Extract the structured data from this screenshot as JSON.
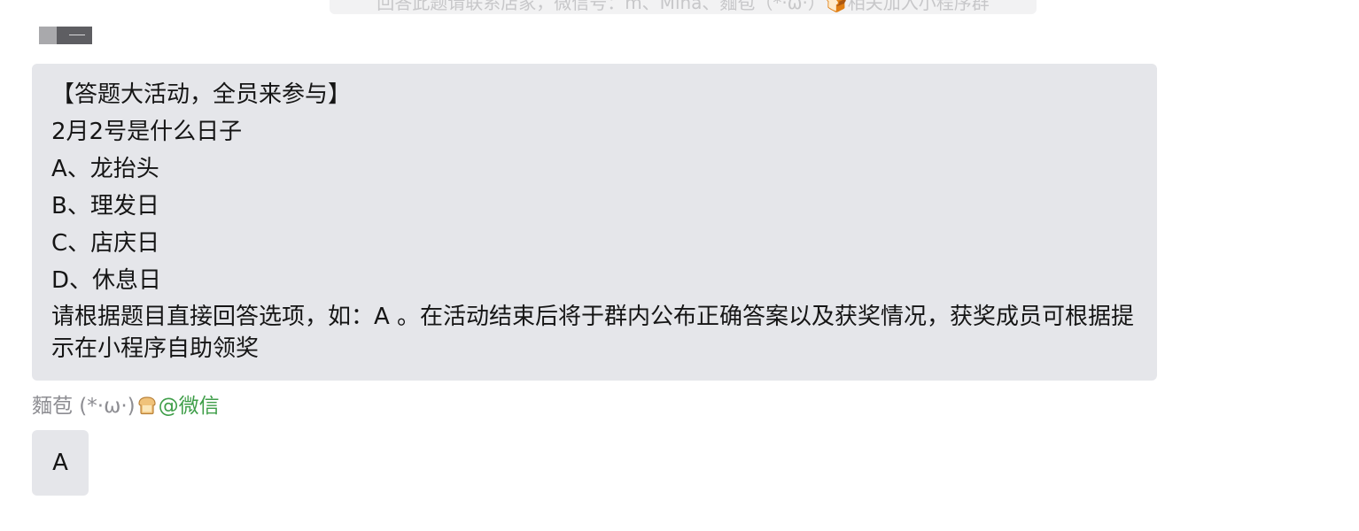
{
  "system_tip": {
    "text": "回答此题请联系店家，微信号：m、Mina、麵苞（*·ω·）🍞相关加入小程序群"
  },
  "question_message": {
    "lines": [
      "【答题大活动，全员来参与】",
      "2月2号是什么日子",
      "A、龙抬头",
      "B、理发日",
      "C、店庆日",
      "D、休息日",
      "请根据题目直接回答选项，如：A 。在活动结束后将于群内公布正确答案以及获奖情况，获奖成员可根据提示在小程序自助领奖"
    ]
  },
  "reply_message": {
    "sender_name": "麵苞 (*·ω·)",
    "sender_emoji_icon": "bread-icon",
    "mention": "@微信",
    "text": "A"
  },
  "colors": {
    "bubble_bg": "#e5e6ea",
    "mention_green": "#3f9e49",
    "sender_gray": "#8d8d92"
  }
}
